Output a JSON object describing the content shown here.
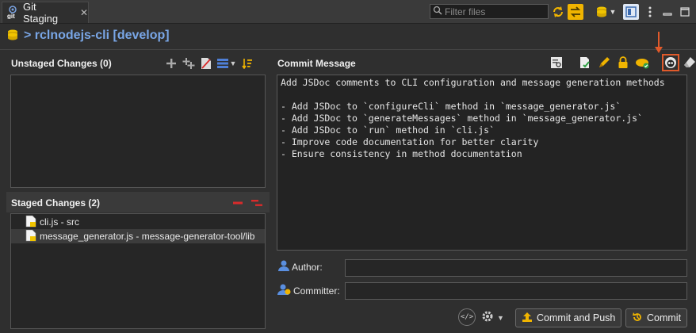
{
  "tab": {
    "title": "Git Staging",
    "icon_badge": "git"
  },
  "filter": {
    "placeholder": "Filter files"
  },
  "repo": {
    "label": "> rclnodejs-cli [develop]"
  },
  "unstaged": {
    "title": "Unstaged Changes (0)"
  },
  "staged": {
    "title": "Staged Changes (2)",
    "files": [
      {
        "name": "cli.js - src",
        "selected": false
      },
      {
        "name": "message_generator.js - message-generator-tool/lib",
        "selected": true
      }
    ]
  },
  "commit": {
    "title": "Commit Message",
    "message": "Add JSDoc comments to CLI configuration and message generation methods\n\n- Add JSDoc to `configureCli` method in `message_generator.js`\n- Add JSDoc to `generateMessages` method in `message_generator.js`\n- Add JSDoc to `run` method in `cli.js`\n- Improve code documentation for better clarity\n- Ensure consistency in method documentation",
    "author_label": "Author:",
    "author_value": "",
    "committer_label": "Committer:",
    "committer_value": "",
    "commit_push_label": "Commit and Push",
    "commit_label": "Commit"
  },
  "colors": {
    "accent_blue": "#79a6e6",
    "highlight_orange": "#e05a2b",
    "remove_red": "#d92b2b",
    "commit_yellow": "#f0b400"
  }
}
